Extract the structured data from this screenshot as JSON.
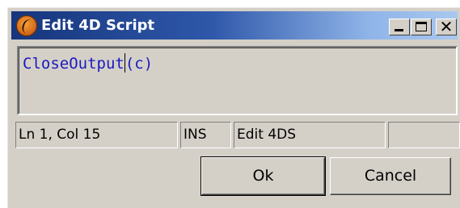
{
  "window": {
    "title": "Edit 4D Script",
    "app_icon": "4d-app-icon",
    "controls": {
      "minimize": "minimize-icon",
      "maximize": "maximize-icon",
      "close": "close-icon"
    }
  },
  "editor": {
    "code_before_caret": "CloseOutput",
    "code_after_caret": "(c)"
  },
  "statusbar": {
    "position": "Ln 1, Col 15",
    "mode": "INS",
    "name": "Edit 4DS",
    "extra": ""
  },
  "buttons": {
    "ok": "Ok",
    "cancel": "Cancel"
  },
  "colors": {
    "title_gradient_start": "#16357c",
    "title_gradient_end": "#a9c8ef",
    "code_text": "#1a1ac0",
    "face": "#d4d0c8"
  }
}
